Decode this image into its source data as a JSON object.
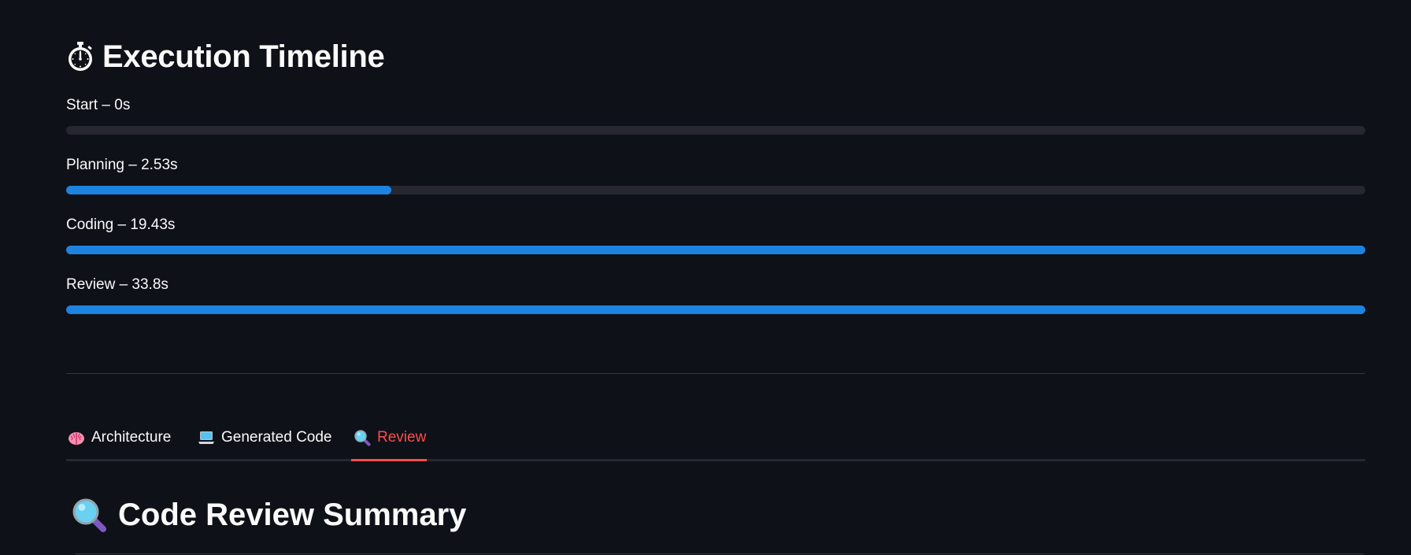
{
  "timeline": {
    "title": "Execution Timeline",
    "title_icon": "stopwatch-icon",
    "bar_color": "#1c83e1",
    "track_color": "#262730",
    "steps": [
      {
        "label": "Start – 0s",
        "progress": 0.0
      },
      {
        "label": "Planning – 2.53s",
        "progress": 0.25
      },
      {
        "label": "Coding – 19.43s",
        "progress": 1.0
      },
      {
        "label": "Review – 33.8s",
        "progress": 1.0
      }
    ]
  },
  "tabs": {
    "active_color": "#ff4b4b",
    "items": [
      {
        "label": "Architecture",
        "icon": "brain-icon",
        "active": false
      },
      {
        "label": "Generated Code",
        "icon": "laptop-icon",
        "active": false
      },
      {
        "label": "Review",
        "icon": "magnifying-glass-icon",
        "active": true
      }
    ]
  },
  "review": {
    "title": "Code Review Summary",
    "title_icon": "magnifying-glass-icon"
  }
}
